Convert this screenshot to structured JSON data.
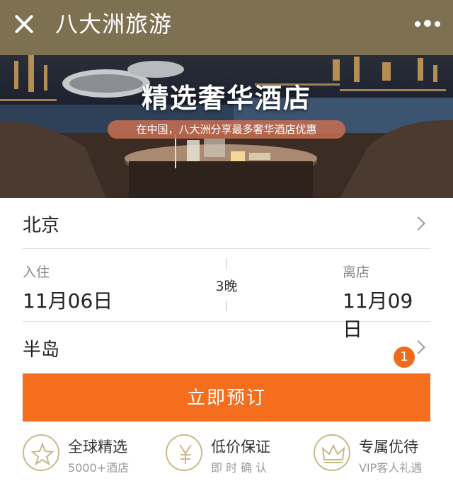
{
  "header": {
    "title": "八大洲旅游",
    "close_icon": "close-icon",
    "more_icon": "more-dots-icon"
  },
  "banner": {
    "headline": "精选奢华酒店",
    "subline": "在中国，八大洲分享最多奢华酒店优惠"
  },
  "search": {
    "city": "北京",
    "checkin_label": "入住",
    "checkin_date": "11月06日",
    "nights": "3晚",
    "checkout_label": "离店",
    "checkout_date": "11月09日",
    "keyword": "半岛",
    "keyword_badge": "1",
    "book_label": "立即预订"
  },
  "features": [
    {
      "icon": "star-icon",
      "title": "全球精选",
      "subtitle": "5000+酒店"
    },
    {
      "icon": "yen-icon",
      "title": "低价保证",
      "subtitle": "即 时 确 认"
    },
    {
      "icon": "crown-icon",
      "title": "专属优待",
      "subtitle": "VIP客人礼遇"
    }
  ],
  "colors": {
    "header_bg": "#7e7152",
    "accent": "#f46e1e",
    "icon_border": "#c9b88a"
  }
}
